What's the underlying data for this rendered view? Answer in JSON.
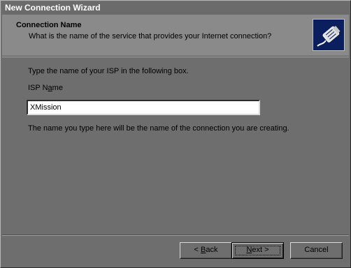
{
  "window": {
    "title": "New Connection Wizard"
  },
  "header": {
    "title": "Connection Name",
    "subtitle": "What is the name of the service that provides your Internet connection?",
    "icon": "cable-connector-icon"
  },
  "main": {
    "instruction": "Type the name of your ISP in the following box.",
    "isp_label_pre": "ISP N",
    "isp_label_accel": "a",
    "isp_label_post": "me",
    "isp_value": "XMission",
    "note": "The name you type here will be the name of the connection you are creating."
  },
  "buttons": {
    "back_prefix": "< ",
    "back_accel": "B",
    "back_rest": "ack",
    "next_accel": "N",
    "next_rest": "ext >",
    "cancel": "Cancel"
  }
}
